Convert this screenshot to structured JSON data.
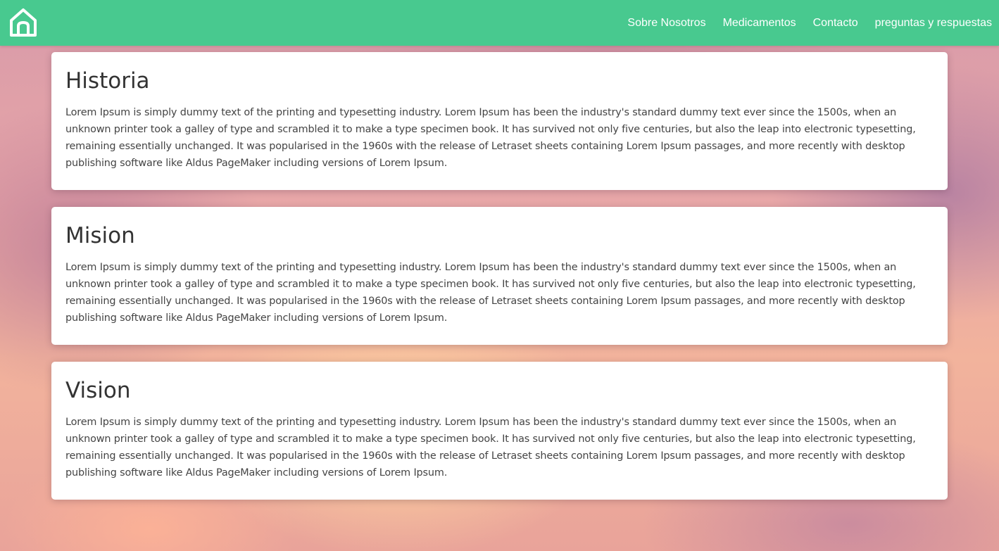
{
  "navbar": {
    "home_icon": "home-icon",
    "links": [
      {
        "label": "Sobre Nosotros"
      },
      {
        "label": "Medicamentos"
      },
      {
        "label": "Contacto"
      },
      {
        "label": "preguntas y respuestas"
      }
    ],
    "background_color": "#48c98f"
  },
  "sections": [
    {
      "title": "Historia",
      "body": "Lorem Ipsum is simply dummy text of the printing and typesetting industry. Lorem Ipsum has been the industry's standard dummy text ever since the 1500s, when an unknown printer took a galley of type and scrambled it to make a type specimen book. It has survived not only five centuries, but also the leap into electronic typesetting, remaining essentially unchanged. It was popularised in the 1960s with the release of Letraset sheets containing Lorem Ipsum passages, and more recently with desktop publishing software like Aldus PageMaker including versions of Lorem Ipsum."
    },
    {
      "title": "Mision",
      "body": "Lorem Ipsum is simply dummy text of the printing and typesetting industry. Lorem Ipsum has been the industry's standard dummy text ever since the 1500s, when an unknown printer took a galley of type and scrambled it to make a type specimen book. It has survived not only five centuries, but also the leap into electronic typesetting, remaining essentially unchanged. It was popularised in the 1960s with the release of Letraset sheets containing Lorem Ipsum passages, and more recently with desktop publishing software like Aldus PageMaker including versions of Lorem Ipsum."
    },
    {
      "title": "Vision",
      "body": "Lorem Ipsum is simply dummy text of the printing and typesetting industry. Lorem Ipsum has been the industry's standard dummy text ever since the 1500s, when an unknown printer took a galley of type and scrambled it to make a type specimen book. It has survived not only five centuries, but also the leap into electronic typesetting, remaining essentially unchanged. It was popularised in the 1960s with the release of Letraset sheets containing Lorem Ipsum passages, and more recently with desktop publishing software like Aldus PageMaker including versions of Lorem Ipsum."
    }
  ]
}
